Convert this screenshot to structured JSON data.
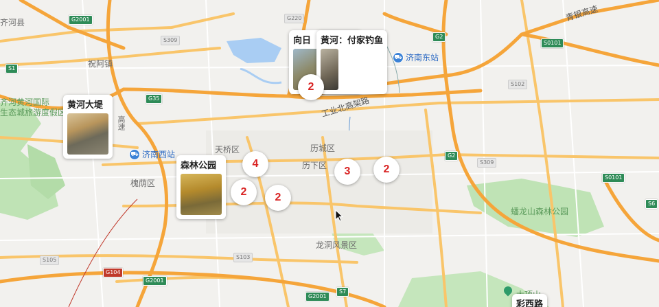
{
  "map": {
    "districts": [
      "天桥区",
      "历城区",
      "历下区",
      "槐荫区",
      "龙洞风景区",
      "祝阿镇"
    ],
    "places": {
      "yellow_river_ecology": "齐河黄河国际\n生态城旅游度假区",
      "county": "齐河县",
      "forest_park_green": "蟠龙山森林公园",
      "dafengshan": "大项山"
    },
    "road_name": "工业北高架路",
    "expressway_label": "青银高速",
    "expressway_label_2": "高速",
    "stations": [
      {
        "name": "济南东站",
        "icon": "rail-station-icon"
      },
      {
        "name": "济南西站",
        "icon": "rail-station-icon"
      }
    ],
    "shields": [
      "G2001",
      "G220",
      "G2",
      "S309",
      "S1",
      "G35",
      "S0101",
      "S102",
      "G2",
      "S309",
      "S0101",
      "S6",
      "S105",
      "G104",
      "G2001",
      "S103",
      "G2001",
      "S7",
      "G2001",
      "S102"
    ],
    "clusters": [
      {
        "count": "2",
        "name": "cluster-north"
      },
      {
        "count": "4",
        "name": "cluster-tianqiao"
      },
      {
        "count": "2",
        "name": "cluster-west-1"
      },
      {
        "count": "2",
        "name": "cluster-west-2"
      },
      {
        "count": "3",
        "name": "cluster-lixia"
      },
      {
        "count": "2",
        "name": "cluster-east"
      }
    ],
    "cards": [
      {
        "title": "黄河大堤"
      },
      {
        "title": "森林公园"
      },
      {
        "title": "向日"
      },
      {
        "title": "黄河：付家钓鱼"
      },
      {
        "title": "彩西路"
      }
    ],
    "colors": {
      "cluster_text": "#d92323",
      "highway": "#f7b14a",
      "expressway": "#f39a2e",
      "water": "#a9cdf3",
      "park": "#b9e2b0",
      "station": "#3b82d6"
    }
  }
}
